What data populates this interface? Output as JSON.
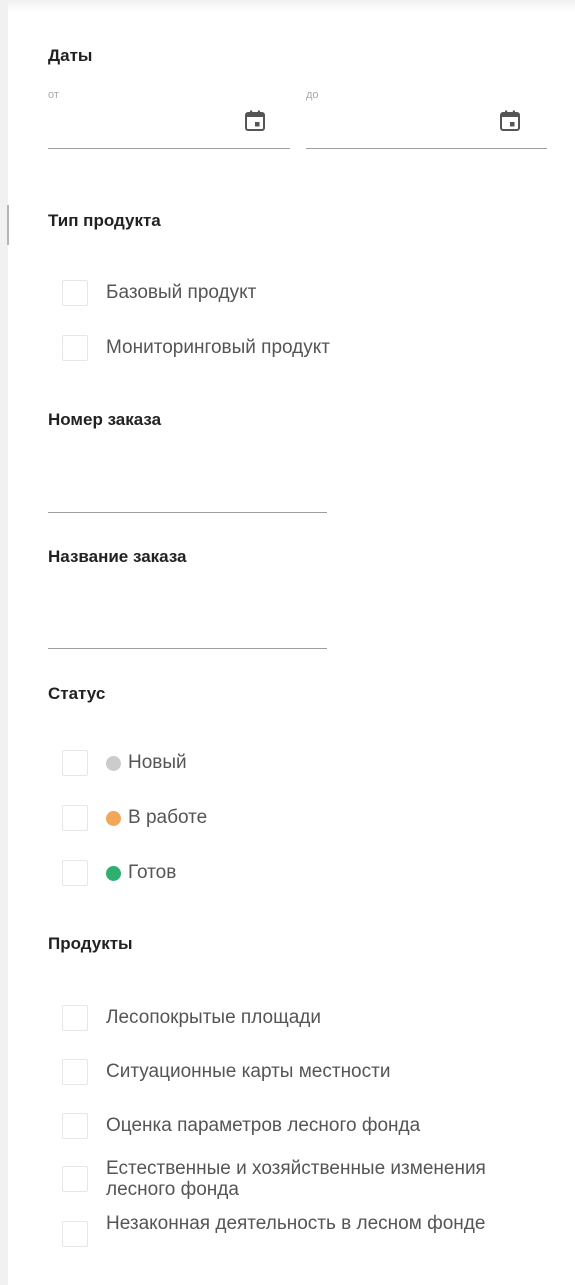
{
  "dates": {
    "title": "Даты",
    "from_label": "от",
    "to_label": "до",
    "calendar_icon": "calendar-icon"
  },
  "product_type": {
    "title": "Тип продукта",
    "options": [
      {
        "label": "Базовый продукт",
        "checked": false
      },
      {
        "label": "Мониторинговый продукт",
        "checked": false
      }
    ]
  },
  "order_number": {
    "title": "Номер заказа",
    "value": ""
  },
  "order_name": {
    "title": "Название заказа",
    "value": ""
  },
  "status": {
    "title": "Статус",
    "options": [
      {
        "label": "Новый",
        "color": "#cccccc",
        "checked": false
      },
      {
        "label": "В работе",
        "color": "#f2a65a",
        "checked": false
      },
      {
        "label": "Готов",
        "color": "#2eaf6f",
        "checked": false
      }
    ]
  },
  "products": {
    "title": "Продукты",
    "options": [
      {
        "label": "Лесопокрытые площади",
        "checked": false
      },
      {
        "label": "Ситуационные карты местности",
        "checked": false
      },
      {
        "label": "Оценка параметров лесного фонда",
        "checked": false
      },
      {
        "label": "Естественные и хозяйственные изменения лесного фонда",
        "checked": false
      },
      {
        "label": "Незаконная деятельность в лесном фонде",
        "checked": false
      }
    ]
  }
}
